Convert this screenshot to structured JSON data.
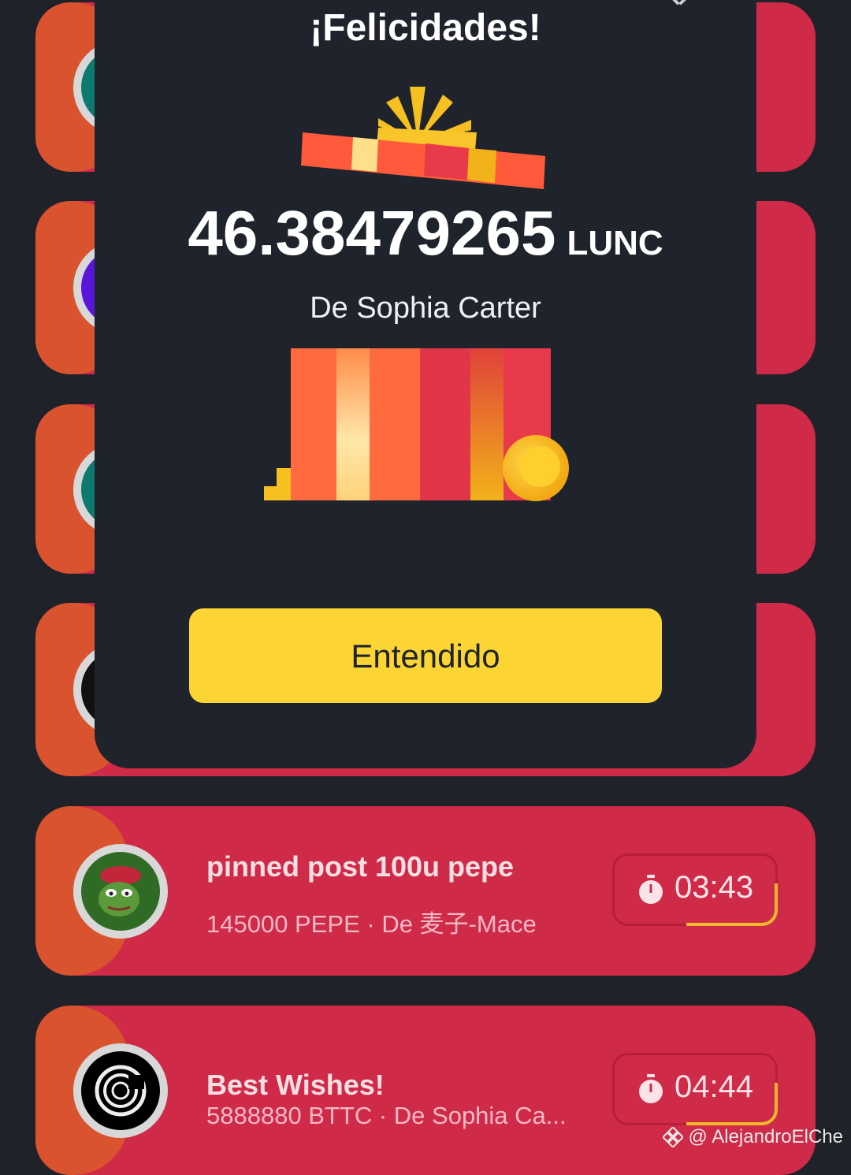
{
  "modal": {
    "title": "¡Felicidades!",
    "amount": "46.38479265",
    "unit": "LUNC",
    "from": "De Sophia Carter",
    "button_label": "Entendido"
  },
  "packets": [
    {
      "title": "pinned post 100u pepe",
      "subtitle": "145000 PEPE · De 麦子-Mace",
      "timer": "03:43"
    },
    {
      "title": "Best Wishes!",
      "subtitle": "5888880 BTTC · De Sophia Ca...",
      "timer": "04:44"
    }
  ],
  "watermark": "@ AlejandroElChe",
  "colors": {
    "background": "#1f2229",
    "card": "#cf2a48",
    "card_band": "#d9542e",
    "accent_yellow": "#fcd535",
    "modal_bg": "#1f232b"
  },
  "icons": [
    "close-icon",
    "gift-lid-icon",
    "gift-box-icon",
    "coin-icon",
    "stopwatch-icon",
    "pepe-avatar",
    "bttc-avatar",
    "binance-logo-icon"
  ]
}
